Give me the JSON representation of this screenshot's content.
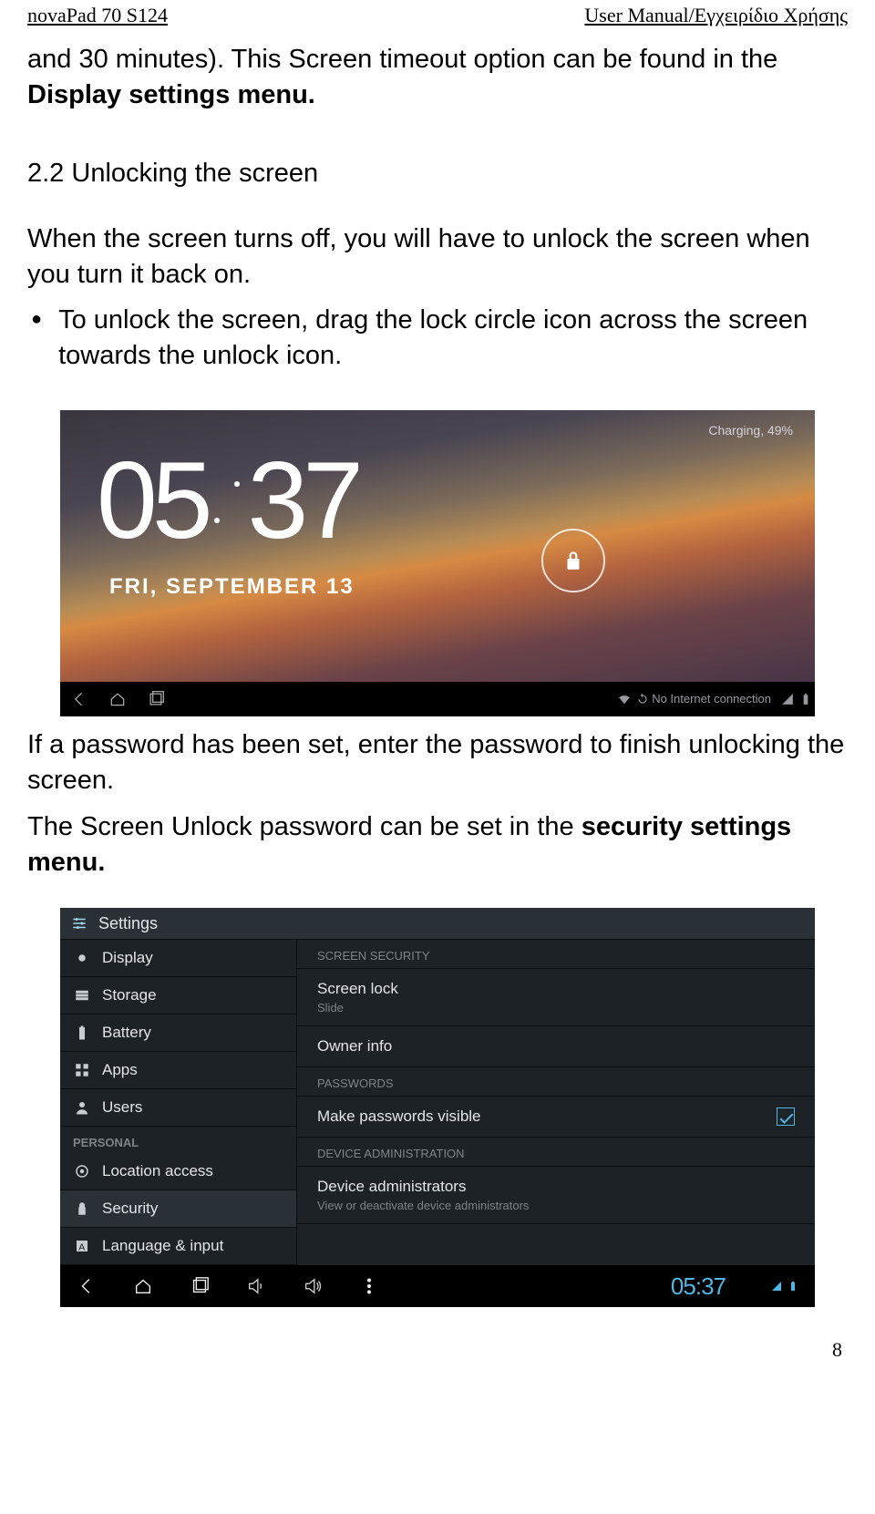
{
  "header": {
    "left": "novaPad 70 S124",
    "right": "User Manual/Εγχειρίδιο Χρήσης"
  },
  "body": {
    "p1_a": "and 30 minutes). This Screen timeout option can be found in the ",
    "p1_b": "Display settings menu.",
    "section": "2.2 Unlocking the screen",
    "p2": "When the screen turns off, you will have to unlock the screen when you turn it back on.",
    "bullet": "To unlock the screen, drag the lock circle icon across the screen towards the unlock icon.",
    "p3": "If a password has been set, enter the password to finish unlocking the screen.",
    "p4_a": "The Screen Unlock password can be set in the ",
    "p4_b": "security settings menu."
  },
  "lockscreen": {
    "hour": "05",
    "min": "37",
    "date": "FRI, SEPTEMBER 13",
    "charging": "Charging, 49%",
    "status": "No Internet connection"
  },
  "settings": {
    "title": "Settings",
    "left": {
      "display": "Display",
      "storage": "Storage",
      "battery": "Battery",
      "apps": "Apps",
      "users": "Users",
      "personal": "PERSONAL",
      "location": "Location access",
      "security": "Security",
      "language": "Language & input"
    },
    "right": {
      "cat1": "SCREEN SECURITY",
      "screenlock": "Screen lock",
      "screenlock_sub": "Slide",
      "owner": "Owner info",
      "cat2": "PASSWORDS",
      "makevisible": "Make passwords visible",
      "cat3": "DEVICE ADMINISTRATION",
      "devadmin": "Device administrators",
      "devadmin_sub": "View or deactivate device administrators"
    },
    "clock": "05:37"
  },
  "pageNumber": "8"
}
